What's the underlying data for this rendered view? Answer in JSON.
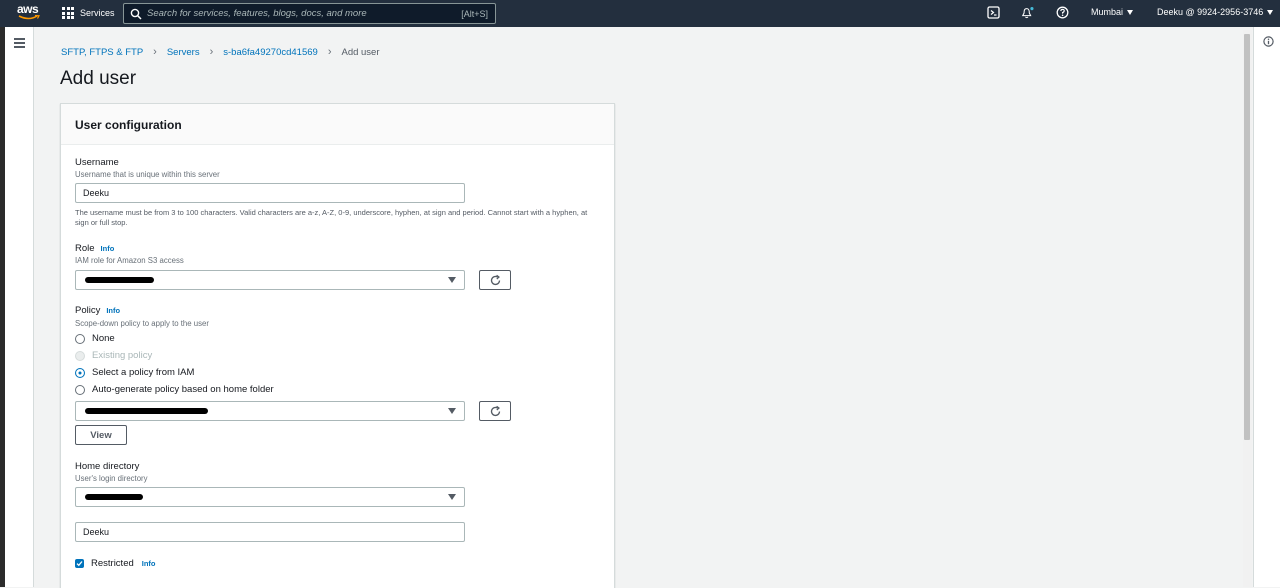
{
  "topnav": {
    "logo": "aws",
    "services_label": "Services",
    "search_placeholder": "Search for services, features, blogs, docs, and more",
    "search_shortcut": "[Alt+S]",
    "region": "Mumbai",
    "account": "Deeku @ 9924-2956-3746"
  },
  "breadcrumb": {
    "items": [
      "SFTP, FTPS & FTP",
      "Servers",
      "s-ba6fa49270cd41569"
    ],
    "current": "Add user"
  },
  "page": {
    "title": "Add user"
  },
  "panel": {
    "title": "User configuration"
  },
  "username": {
    "label": "Username",
    "description": "Username that is unique within this server",
    "value": "Deeku",
    "help": "The username must be from 3 to 100 characters. Valid characters are a-z, A-Z, 0-9, underscore, hyphen, at sign and period. Cannot start with a hyphen, at sign or full stop."
  },
  "role": {
    "label": "Role",
    "info": "Info",
    "description": "IAM role for Amazon S3 access"
  },
  "policy": {
    "label": "Policy",
    "info": "Info",
    "description": "Scope-down policy to apply to the user",
    "options": [
      "None",
      "Existing policy",
      "Select a policy from IAM",
      "Auto-generate policy based on home folder"
    ],
    "view_label": "View"
  },
  "home": {
    "label": "Home directory",
    "description": "User's login directory",
    "path_value": "Deeku"
  },
  "restricted": {
    "label": "Restricted",
    "info": "Info"
  },
  "colors": {
    "nav": "#232f3e",
    "link": "#0073bb",
    "checked": "#0073bb"
  }
}
